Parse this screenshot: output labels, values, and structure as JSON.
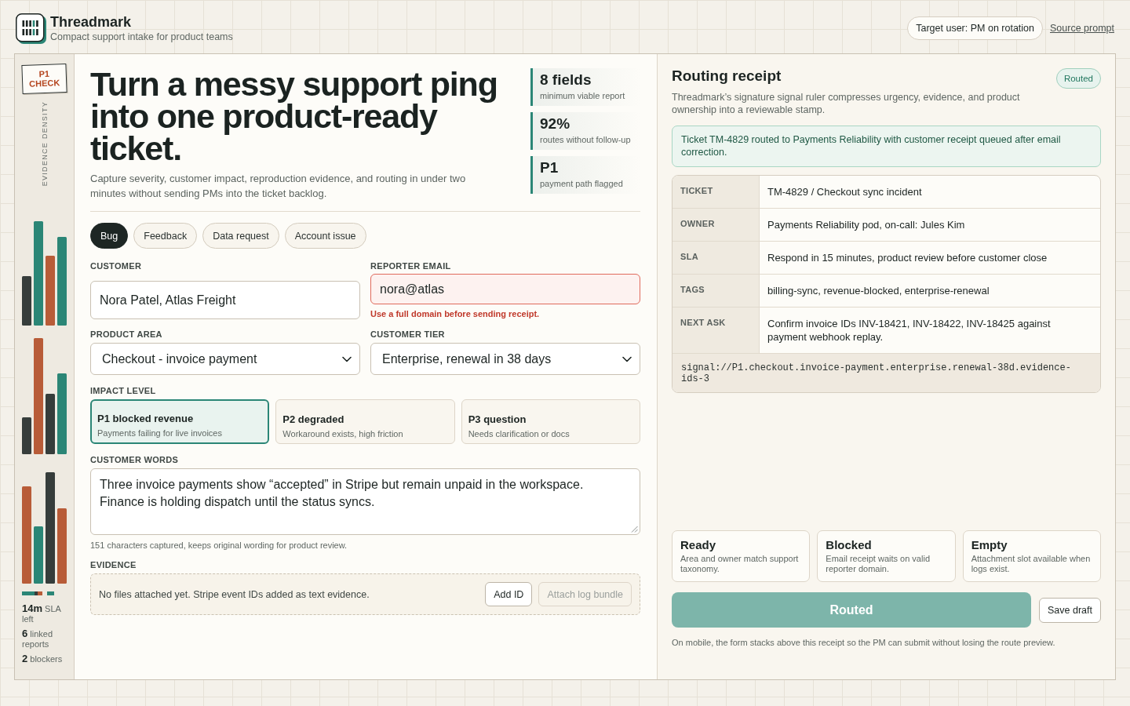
{
  "app": {
    "name": "Threadmark",
    "tagline": "Compact support intake for product teams"
  },
  "header": {
    "target_user": "Target user: PM on rotation",
    "source_link": "Source prompt"
  },
  "rail": {
    "stamp": "P1 CHECK",
    "label": "EVIDENCE DENSITY",
    "stats": [
      "**14m** SLA left",
      "**6** linked reports",
      "**2** blockers"
    ]
  },
  "hero": {
    "title": "Turn a messy support ping into one product-ready ticket.",
    "subtitle": "Capture severity, customer impact, reproduction evidence, and routing in under two minutes without sending PMs into the ticket backlog.",
    "stats": [
      {
        "value": "8 fields",
        "label": "minimum viable report"
      },
      {
        "value": "92%",
        "label": "routes without follow-up"
      },
      {
        "value": "P1",
        "label": "payment path flagged"
      }
    ]
  },
  "request_types": [
    {
      "label": "Bug",
      "selected": true
    },
    {
      "label": "Feedback",
      "selected": false
    },
    {
      "label": "Data request",
      "selected": false
    },
    {
      "label": "Account issue",
      "selected": false
    }
  ],
  "form": {
    "customer": {
      "label": "CUSTOMER",
      "value": "Nora Patel, Atlas Freight",
      "invalid": false
    },
    "reporter_email": {
      "label": "REPORTER EMAIL",
      "value": "nora@atlas",
      "invalid": true,
      "error": "Use a full domain before sending receipt."
    },
    "product_area": {
      "label": "PRODUCT AREA",
      "value": "Checkout - invoice payment"
    },
    "customer_tier": {
      "label": "CUSTOMER TIER",
      "value": "Enterprise, renewal in 38 days"
    },
    "impact_level": {
      "label": "IMPACT LEVEL",
      "options": [
        {
          "title": "P1 blocked revenue",
          "description": "Payments failing for live invoices",
          "selected": true
        },
        {
          "title": "P2 degraded",
          "description": "Workaround exists, high friction",
          "selected": false
        },
        {
          "title": "P3 question",
          "description": "Needs clarification or docs",
          "selected": false
        }
      ]
    },
    "customer_words": {
      "label": "CUSTOMER WORDS",
      "value": "Three invoice payments show “accepted” in Stripe but remain unpaid in the workspace. Finance is holding dispatch until the status syncs.",
      "helper": "151 characters captured, keeps original wording for product review."
    },
    "evidence": {
      "label": "EVIDENCE",
      "note": "No files attached yet. Stripe event IDs added as text evidence.",
      "buttons": [
        {
          "label": "Add ID",
          "disabled": false
        },
        {
          "label": "Attach log bundle",
          "disabled": true
        }
      ]
    }
  },
  "receipt": {
    "title": "Routing receipt",
    "status": "Routed",
    "description": "Threadmark’s signature signal ruler compresses urgency, evidence, and product ownership into a reviewable stamp.",
    "alert": "Ticket TM-4829 routed to Payments Reliability with customer receipt queued after email correction.",
    "fields": [
      {
        "label": "TICKET",
        "value": "TM-4829 / Checkout sync incident"
      },
      {
        "label": "OWNER",
        "value": "Payments Reliability pod, on-call: Jules Kim"
      },
      {
        "label": "SLA",
        "value": "Respond in 15 minutes, product review before customer close"
      },
      {
        "label": "TAGS",
        "value": "billing-sync, revenue-blocked, enterprise-renewal"
      },
      {
        "label": "NEXT ASK",
        "value": "Confirm invoice IDs INV-18421, INV-18422, INV-18425 against payment webhook replay."
      }
    ],
    "signal": "signal://P1.checkout.invoice-payment.enterprise.renewal-38d.evidence-ids-3",
    "checks": [
      {
        "title": "Ready",
        "description": "Area and owner match support taxonomy."
      },
      {
        "title": "Blocked",
        "description": "Email receipt waits on valid reporter domain."
      },
      {
        "title": "Empty",
        "description": "Attachment slot available when logs exist."
      }
    ],
    "primary_button": "Routed",
    "secondary_button": "Save draft",
    "footnote": "On mobile, the form stacks above this receipt so the PM can submit without losing the route preview."
  }
}
